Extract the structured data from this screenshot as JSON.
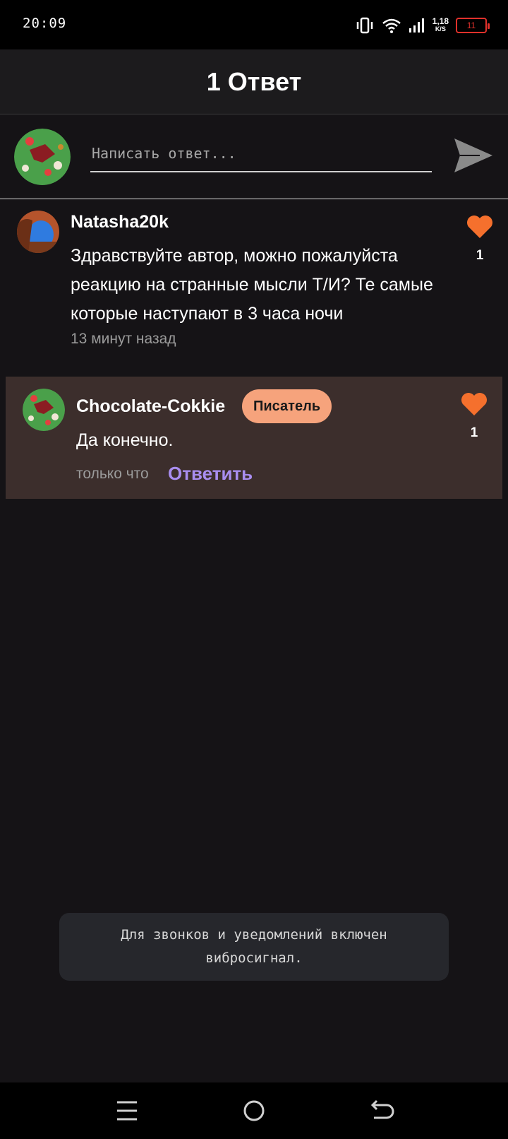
{
  "status_bar": {
    "time": "20:09",
    "speed_value": "1,18",
    "speed_unit": "K/S",
    "battery": "11"
  },
  "header": {
    "title": "1 Ответ"
  },
  "composer": {
    "placeholder": "Написать ответ..."
  },
  "comment": {
    "username": "Natasha20k",
    "text": "Здравствуйте автор, можно пожалуйста реакцию на странные мысли Т/И? Те самые которые наступают в 3 часа ночи",
    "time": "13 минут назад",
    "likes": "1"
  },
  "reply": {
    "username": "Chocolate-Cokkie",
    "badge": "Писатель",
    "text": "Да конечно.",
    "time": "только что",
    "reply_label": "Ответить",
    "likes": "1"
  },
  "toast": {
    "text": "Для звонков и уведомлений включен вибросигнал."
  },
  "colors": {
    "like": "#f5702d",
    "badge_bg": "#f6a37c",
    "link": "#a98ef0",
    "reply_bg": "#3c2e2c"
  },
  "icons": {
    "send": "send-icon",
    "like": "heart-icon",
    "nav": [
      "menu-icon",
      "home-icon",
      "back-icon"
    ]
  }
}
